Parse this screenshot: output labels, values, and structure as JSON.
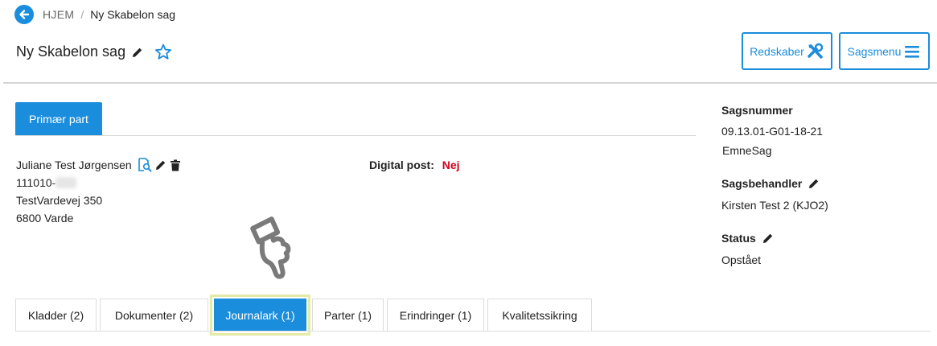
{
  "breadcrumb": {
    "home": "HJEM",
    "separator": "/",
    "current": "Ny Skabelon sag"
  },
  "header": {
    "title": "Ny Skabelon sag",
    "buttons": {
      "redskaber": "Redskaber",
      "sagsmenu": "Sagsmenu"
    }
  },
  "party": {
    "tab_label": "Primær part",
    "name": "Juliane Test Jørgensen",
    "cpr_visible": "111010-",
    "address": "TestVardevej 350",
    "city": "6800 Varde",
    "digital_post_label": "Digital post:",
    "digital_post_value": "Nej"
  },
  "side": {
    "sagsnummer_label": "Sagsnummer",
    "sagsnummer_value": "09.13.01-G01-18-21",
    "sagstype": "EmneSag",
    "sagsbehandler_label": "Sagsbehandler",
    "sagsbehandler_value": "Kirsten Test 2 (KJO2)",
    "status_label": "Status",
    "status_value": "Opstået"
  },
  "tabs": [
    {
      "label": "Kladder (2)"
    },
    {
      "label": "Dokumenter (2)"
    },
    {
      "label": "Journalark (1)",
      "active": true
    },
    {
      "label": "Parter (1)"
    },
    {
      "label": "Erindringer (1)"
    },
    {
      "label": "Kvalitetssikring"
    }
  ],
  "colors": {
    "accent": "#1a8ddc",
    "negative": "#d0021b",
    "highlight": "#e4eba6"
  },
  "icons": [
    "arrow-left-icon",
    "pencil-icon",
    "star-icon",
    "tools-icon",
    "menu-icon",
    "search-document-icon",
    "trash-icon",
    "pointing-hand-icon"
  ]
}
